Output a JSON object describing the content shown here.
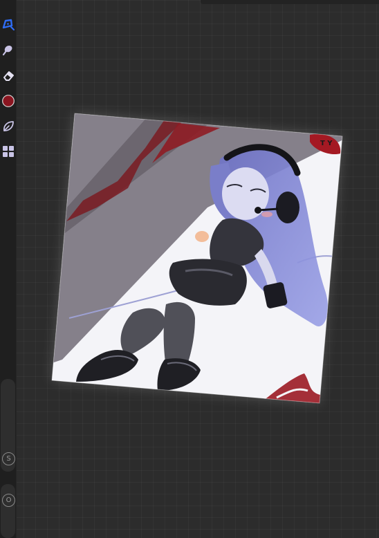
{
  "app": {
    "name": "Drawing canvas"
  },
  "toolbar": {
    "tools": [
      {
        "name": "brush",
        "icon": "pen-nib-icon",
        "active": true
      },
      {
        "name": "smudge",
        "icon": "smudge-icon",
        "active": false
      },
      {
        "name": "eraser",
        "icon": "eraser-icon",
        "active": false
      },
      {
        "name": "color",
        "icon": "color-swatch-icon",
        "active": false
      },
      {
        "name": "layers",
        "icon": "leaf-icon",
        "active": false
      },
      {
        "name": "gallery",
        "icon": "grid-icon",
        "active": false
      }
    ],
    "size_slider_label": "S",
    "opacity_slider_label": "O"
  },
  "colors": {
    "active_tool": "#2f6df6",
    "tool_icon": "#c9c4e6",
    "current_color": "#8a1520",
    "background": "#2c2c2c",
    "toolbar_bg": "#1f1f1f"
  },
  "artwork": {
    "signature": "T Y"
  }
}
